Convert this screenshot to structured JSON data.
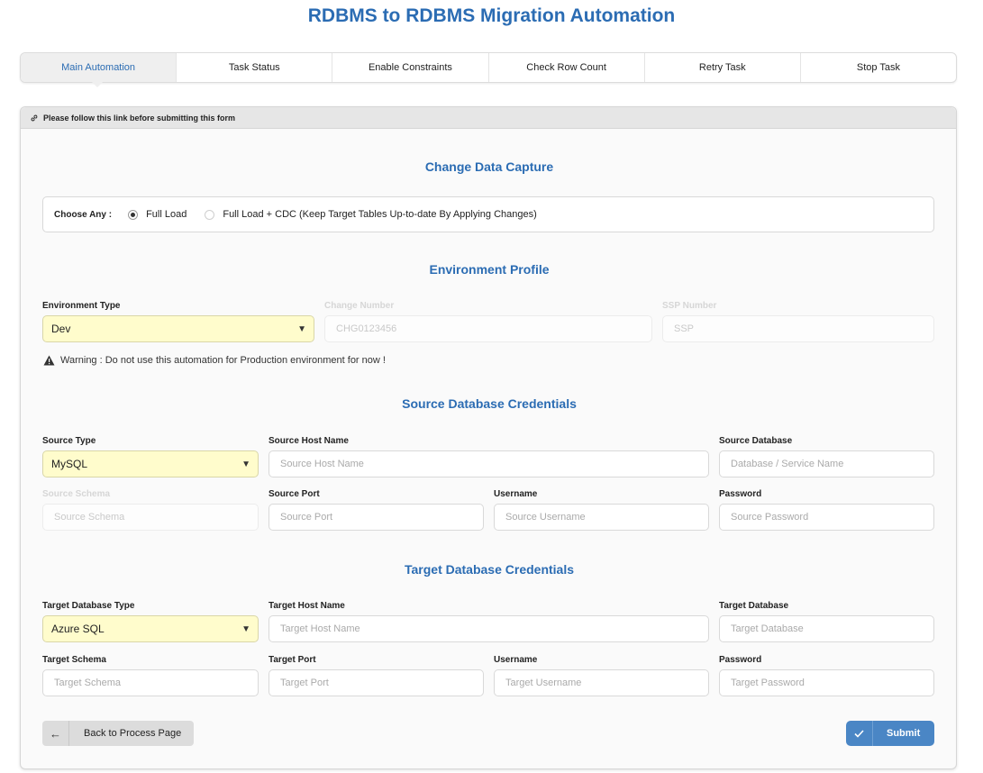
{
  "page": {
    "title": "RDBMS to RDBMS Migration Automation"
  },
  "tabs": [
    {
      "label": "Main Automation",
      "active": true
    },
    {
      "label": "Task Status"
    },
    {
      "label": "Enable Constraints"
    },
    {
      "label": "Check Row Count"
    },
    {
      "label": "Retry Task"
    },
    {
      "label": "Stop Task"
    }
  ],
  "panel": {
    "header": "Please follow this link before submitting this form"
  },
  "cdc": {
    "title": "Change Data Capture",
    "choose_label": "Choose Any :",
    "options": [
      {
        "label": "Full Load",
        "checked": true
      },
      {
        "label": "Full Load + CDC (Keep Target Tables Up-to-date By Applying Changes)",
        "checked": false
      }
    ]
  },
  "env": {
    "title": "Environment Profile",
    "type_label": "Environment Type",
    "type_value": "Dev",
    "change_label": "Change Number",
    "change_placeholder": "CHG0123456",
    "ssp_label": "SSP Number",
    "ssp_placeholder": "SSP",
    "warning": "Warning : Do not use this automation for Production environment for now !"
  },
  "source": {
    "title": "Source Database Credentials",
    "type_label": "Source Type",
    "type_value": "MySQL",
    "host_label": "Source Host Name",
    "host_placeholder": "Source Host Name",
    "db_label": "Source Database",
    "db_placeholder": "Database / Service Name",
    "schema_label": "Source Schema",
    "schema_placeholder": "Source Schema",
    "port_label": "Source Port",
    "port_placeholder": "Source Port",
    "user_label": "Username",
    "user_placeholder": "Source Username",
    "pass_label": "Password",
    "pass_placeholder": "Source Password"
  },
  "target": {
    "title": "Target Database Credentials",
    "type_label": "Target Database Type",
    "type_value": "Azure SQL",
    "host_label": "Target Host Name",
    "host_placeholder": "Target Host Name",
    "db_label": "Target Database",
    "db_placeholder": "Target Database",
    "schema_label": "Target Schema",
    "schema_placeholder": "Target Schema",
    "port_label": "Target Port",
    "port_placeholder": "Target Port",
    "user_label": "Username",
    "user_placeholder": "Target Username",
    "pass_label": "Password",
    "pass_placeholder": "Target Password"
  },
  "buttons": {
    "back": "Back to Process Page",
    "submit": "Submit"
  },
  "colors": {
    "accent": "#2b6cb3",
    "select_bg": "#fffccc",
    "submit_bg": "#4a86c5"
  }
}
